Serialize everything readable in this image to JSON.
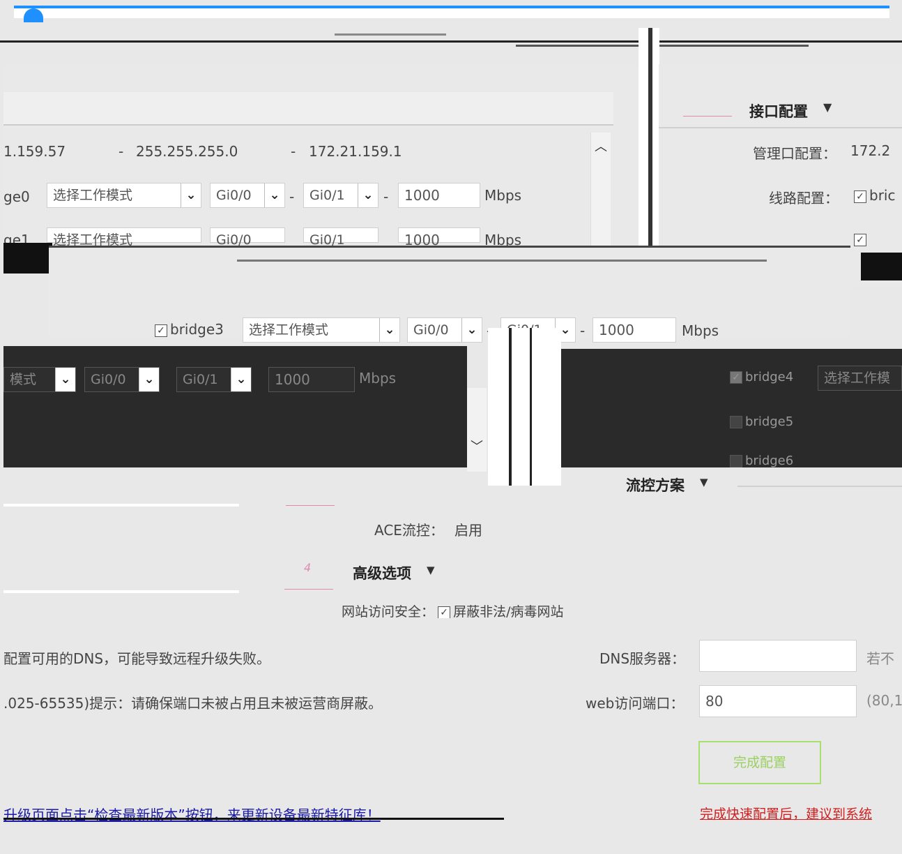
{
  "interface_config": {
    "title": "接口配置",
    "mgmt_label": "管理口配置：",
    "mgmt_value": "172.2",
    "line_label": "线路配置：",
    "line_bridge": "bric"
  },
  "network": {
    "ip": "1.159.57",
    "mask": "255.255.255.0",
    "gateway": "172.21.159.1"
  },
  "bridges": [
    {
      "name": "ge0",
      "mode": "选择工作模式",
      "port_a": "Gi0/0",
      "port_b": "Gi0/1",
      "speed": "1000",
      "unit": "Mbps"
    },
    {
      "name": "ge1",
      "mode": "选择工作模式",
      "port_a": "Gi0/0",
      "port_b": "Gi0/1",
      "speed": "1000",
      "unit": "Mbps"
    },
    {
      "name": "bridge3",
      "mode": "选择工作模式",
      "port_a": "Gi0/0",
      "port_b": "Gi0/1",
      "speed": "1000",
      "unit": "Mbps"
    },
    {
      "name": "",
      "mode": "模式",
      "port_a": "Gi0/0",
      "port_b": "Gi0/1",
      "speed": "1000",
      "unit": "Mbps"
    }
  ],
  "right_bridges": [
    {
      "name": "bridge4",
      "mode": "选择工作模",
      "checked": true
    },
    {
      "name": "bridge5",
      "checked": false
    },
    {
      "name": "bridge6",
      "checked": false
    }
  ],
  "flow_control": {
    "title": "流控方案",
    "ace_label": "ACE流控：",
    "ace_value": "启用"
  },
  "advanced": {
    "step": "4",
    "title": "高级选项",
    "web_security_label": "网站访问安全：",
    "web_security_option": "屏蔽非法/病毒网站",
    "dns_hint": "配置可用的DNS，可能导致远程升级失败。",
    "dns_label": "DNS服务器：",
    "dns_value": "",
    "dns_suffix": "若不",
    "port_hint": ".025-65535)提示：请确保端口未被占用且未被运营商屏蔽。",
    "port_label": "web访问端口：",
    "port_value": "80",
    "port_suffix": "(80,1"
  },
  "footer": {
    "upgrade_link": "升级页面点击“检查最新版本”按钮，来更新设备最新特征库！",
    "finish_link": "完成快速配置后，建议到系统",
    "confirm_button": "完成配置"
  }
}
